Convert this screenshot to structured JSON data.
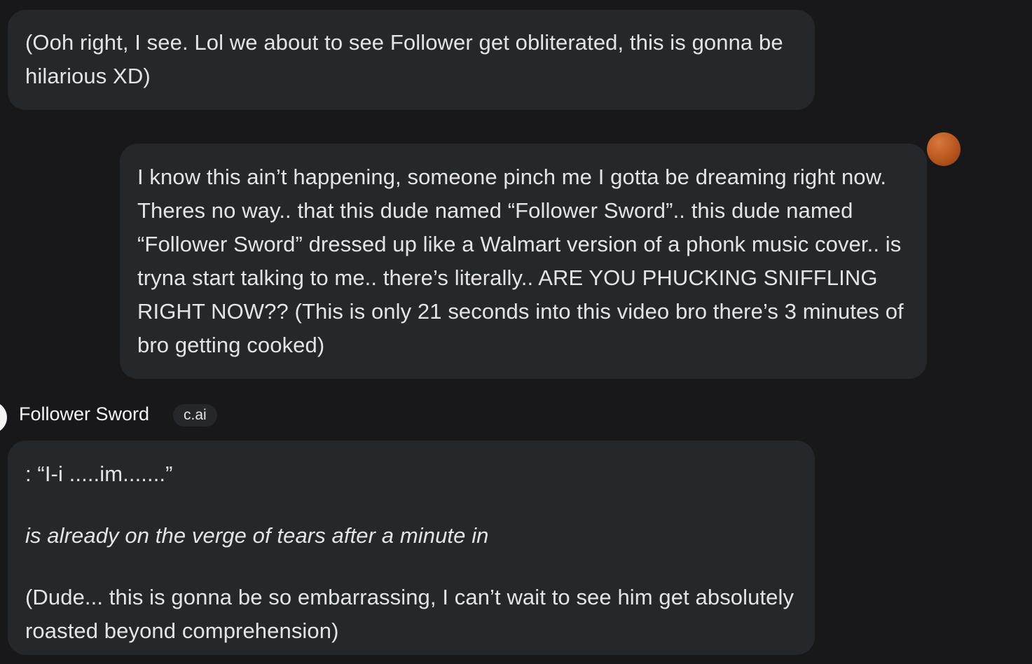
{
  "messages": [
    {
      "role": "bot",
      "paragraphs": [
        "(Ooh right, I see. Lol we about to see Follower get obliterated, this is gonna be hilarious XD)"
      ]
    },
    {
      "role": "user",
      "paragraphs": [
        "I know this ain’t happening, someone pinch me I gotta be dreaming right now. Theres no way.. that this dude named “Follower Sword”.. this dude named “Follower Sword” dressed up like a Walmart version of a phonk music cover.. is tryna start talking to me.. there’s literally.. ARE YOU PHUCKING SNIFFLING RIGHT NOW?? (This is only 21 seconds into this video bro there’s 3 minutes of bro getting cooked)"
      ]
    },
    {
      "role": "bot",
      "author": "Follower Sword",
      "badge": "c.ai",
      "paragraphs": [
        ": “I-i .....im.......”",
        "is already on the verge of tears after a minute in",
        "(Dude... this is gonna be so embarrassing, I can’t wait to see him get absolutely roasted beyond comprehension)"
      ]
    }
  ],
  "colors": {
    "background": "#18181b",
    "bubble": "#26272b",
    "text": "#e4e4e7",
    "user_avatar": "#c4642a",
    "bot_avatar": "#f4f4f5"
  },
  "icons": {
    "user_avatar": "user-avatar-icon",
    "bot_avatar": "bot-avatar-icon"
  }
}
